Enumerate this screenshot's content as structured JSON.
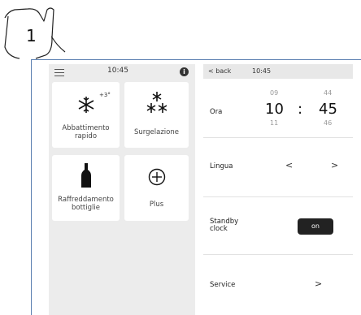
{
  "callout": {
    "number": "1"
  },
  "left_panel": {
    "time": "10:45",
    "info_icon": "i",
    "tiles": [
      {
        "label": "Abbattimento rapido",
        "badge": "+3°",
        "icon": "snowflake-icon"
      },
      {
        "label": "Surgelazione",
        "icon": "snowflakes-icon"
      },
      {
        "label": "Raffreddamento bottiglie",
        "icon": "bottle-icon"
      },
      {
        "label": "Plus",
        "icon": "plus-circle-icon"
      }
    ]
  },
  "right_panel": {
    "back_label": "back",
    "time": "10:45",
    "ora": {
      "label": "Ora",
      "hour_prev": "09",
      "hour": "10",
      "hour_next": "11",
      "separator": ":",
      "min_prev": "44",
      "min": "45",
      "min_next": "46"
    },
    "lingua": {
      "label": "Lingua",
      "prev": "<",
      "next": ">"
    },
    "standby": {
      "label_line1": "Standby",
      "label_line2": "clock",
      "toggle": "on"
    },
    "service": {
      "label": "Service",
      "arrow": ">"
    }
  },
  "colors": {
    "frame_line": "#5a7fb0",
    "panel_bg": "#ececec",
    "toggle_bg": "#222222"
  }
}
